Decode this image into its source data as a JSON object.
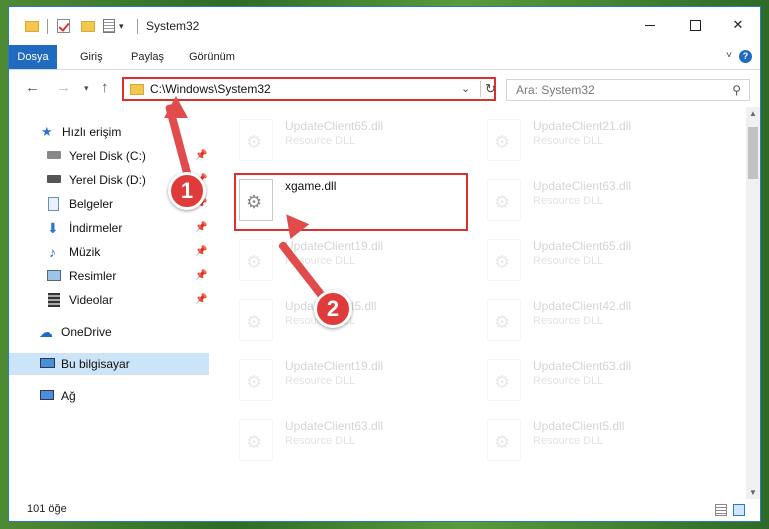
{
  "window": {
    "title": "System32",
    "controls": {
      "minimize": "",
      "maximize": "",
      "close": "✕"
    }
  },
  "ribbon": {
    "tabs": [
      "Dosya",
      "Giriş",
      "Paylaş",
      "Görünüm"
    ],
    "help": "?"
  },
  "address": {
    "path": "C:\\Windows\\System32",
    "search_placeholder": "Ara: System32"
  },
  "nav": {
    "items": [
      {
        "label": "Hızlı erişim",
        "icon": "star-icon",
        "pinned": false
      },
      {
        "label": "Yerel Disk (C:)",
        "icon": "drive-icon",
        "pinned": true
      },
      {
        "label": "Yerel Disk (D:)",
        "icon": "drive-icon",
        "pinned": true
      },
      {
        "label": "Belgeler",
        "icon": "documents-icon",
        "pinned": true
      },
      {
        "label": "İndirmeler",
        "icon": "download-icon",
        "pinned": true
      },
      {
        "label": "Müzik",
        "icon": "music-icon",
        "pinned": true
      },
      {
        "label": "Resimler",
        "icon": "pictures-icon",
        "pinned": true
      },
      {
        "label": "Videolar",
        "icon": "videos-icon",
        "pinned": true
      },
      {
        "label": "OneDrive",
        "icon": "cloud-icon",
        "pinned": false
      },
      {
        "label": "Bu bilgisayar",
        "icon": "computer-icon",
        "pinned": false,
        "selected": true
      },
      {
        "label": "Ağ",
        "icon": "network-icon",
        "pinned": false
      }
    ]
  },
  "files": {
    "left": [
      {
        "name": "UpdateClient65.dll",
        "type": "Resource DLL",
        "faded": true
      },
      {
        "name": "xgame.dll",
        "type": "",
        "faded": false
      },
      {
        "name": "UpdateClient19.dll",
        "type": "Resource DLL",
        "faded": true
      },
      {
        "name": "UpdateClient5.dll",
        "type": "Resource DLL",
        "faded": true
      },
      {
        "name": "UpdateClient19.dll",
        "type": "Resource DLL",
        "faded": true
      },
      {
        "name": "UpdateClient63.dll",
        "type": "Resource DLL",
        "faded": true
      }
    ],
    "right": [
      {
        "name": "UpdateClient21.dll",
        "type": "Resource DLL",
        "faded": true
      },
      {
        "name": "UpdateClient63.dll",
        "type": "Resource DLL",
        "faded": true
      },
      {
        "name": "UpdateClient65.dll",
        "type": "Resource DLL",
        "faded": true
      },
      {
        "name": "UpdateClient42.dll",
        "type": "Resource DLL",
        "faded": true
      },
      {
        "name": "UpdateClient63.dll",
        "type": "Resource DLL",
        "faded": true
      },
      {
        "name": "UpdateClient5.dll",
        "type": "Resource DLL",
        "faded": true
      }
    ]
  },
  "status": {
    "count": "101 öğe"
  },
  "annotations": {
    "step1": "1",
    "step2": "2",
    "color": "#e24b4b"
  }
}
